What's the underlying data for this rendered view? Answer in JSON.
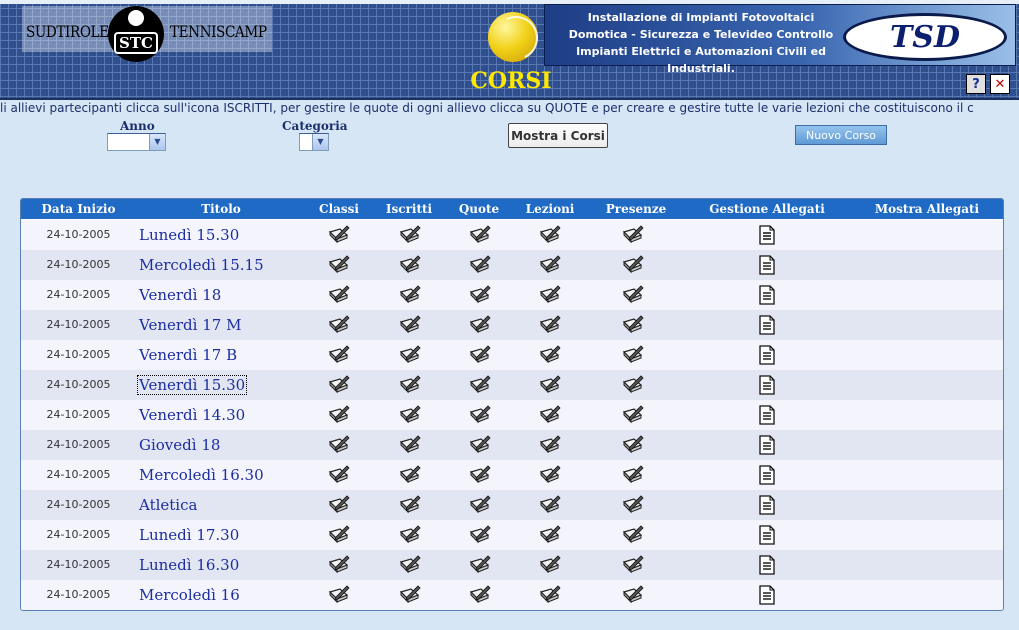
{
  "header": {
    "logo_left": "SUDTIROLER",
    "logo_center": "STC",
    "logo_right": "TENNISCAMP",
    "banner_lines": [
      "Installazione di Impianti Fotovoltaici",
      "Domotica - Sicurezza e Televideo Controllo",
      "Impianti Elettrici e  Automazioni Civili ed Industriali."
    ],
    "banner_logo": "TSD",
    "page_title": "CORSI",
    "help_label": "?",
    "close_label": "✕"
  },
  "instructions": "li allievi partecipanti clicca sull'icona ISCRITTI, per gestire le quote di ogni allievo clicca su QUOTE e per creare e gestire tutte le varie lezioni che costituiscono il c",
  "filters": {
    "anno_label": "Anno",
    "anno_value": "",
    "categoria_label": "Categoria",
    "categoria_value": ""
  },
  "buttons": {
    "mostra": "Mostra i Corsi",
    "nuovo": "Nuovo Corso"
  },
  "table": {
    "columns": [
      "Data Inizio",
      "Titolo",
      "Classi",
      "Iscritti",
      "Quote",
      "Lezioni",
      "Presenze",
      "Gestione Allegati",
      "Mostra Allegati"
    ],
    "rows": [
      {
        "date": "24-10-2005",
        "title": "Lunedì 15.30"
      },
      {
        "date": "24-10-2005",
        "title": "Mercoledì 15.15"
      },
      {
        "date": "24-10-2005",
        "title": "Venerdì 18"
      },
      {
        "date": "24-10-2005",
        "title": "Venerdì 17 M"
      },
      {
        "date": "24-10-2005",
        "title": "Venerdì 17 B"
      },
      {
        "date": "24-10-2005",
        "title": "Venerdì 15.30"
      },
      {
        "date": "24-10-2005",
        "title": "Venerdì 14.30"
      },
      {
        "date": "24-10-2005",
        "title": "Giovedì 18"
      },
      {
        "date": "24-10-2005",
        "title": "Mercoledì 16.30"
      },
      {
        "date": "24-10-2005",
        "title": "Atletica"
      },
      {
        "date": "24-10-2005",
        "title": "Lunedì 17.30"
      },
      {
        "date": "24-10-2005",
        "title": "Lunedì 16.30"
      },
      {
        "date": "24-10-2005",
        "title": "Mercoledì 16"
      }
    ],
    "focused_row": 5,
    "row_icon": "edit-pencil-icon",
    "attachment_icon": "document-icon"
  }
}
